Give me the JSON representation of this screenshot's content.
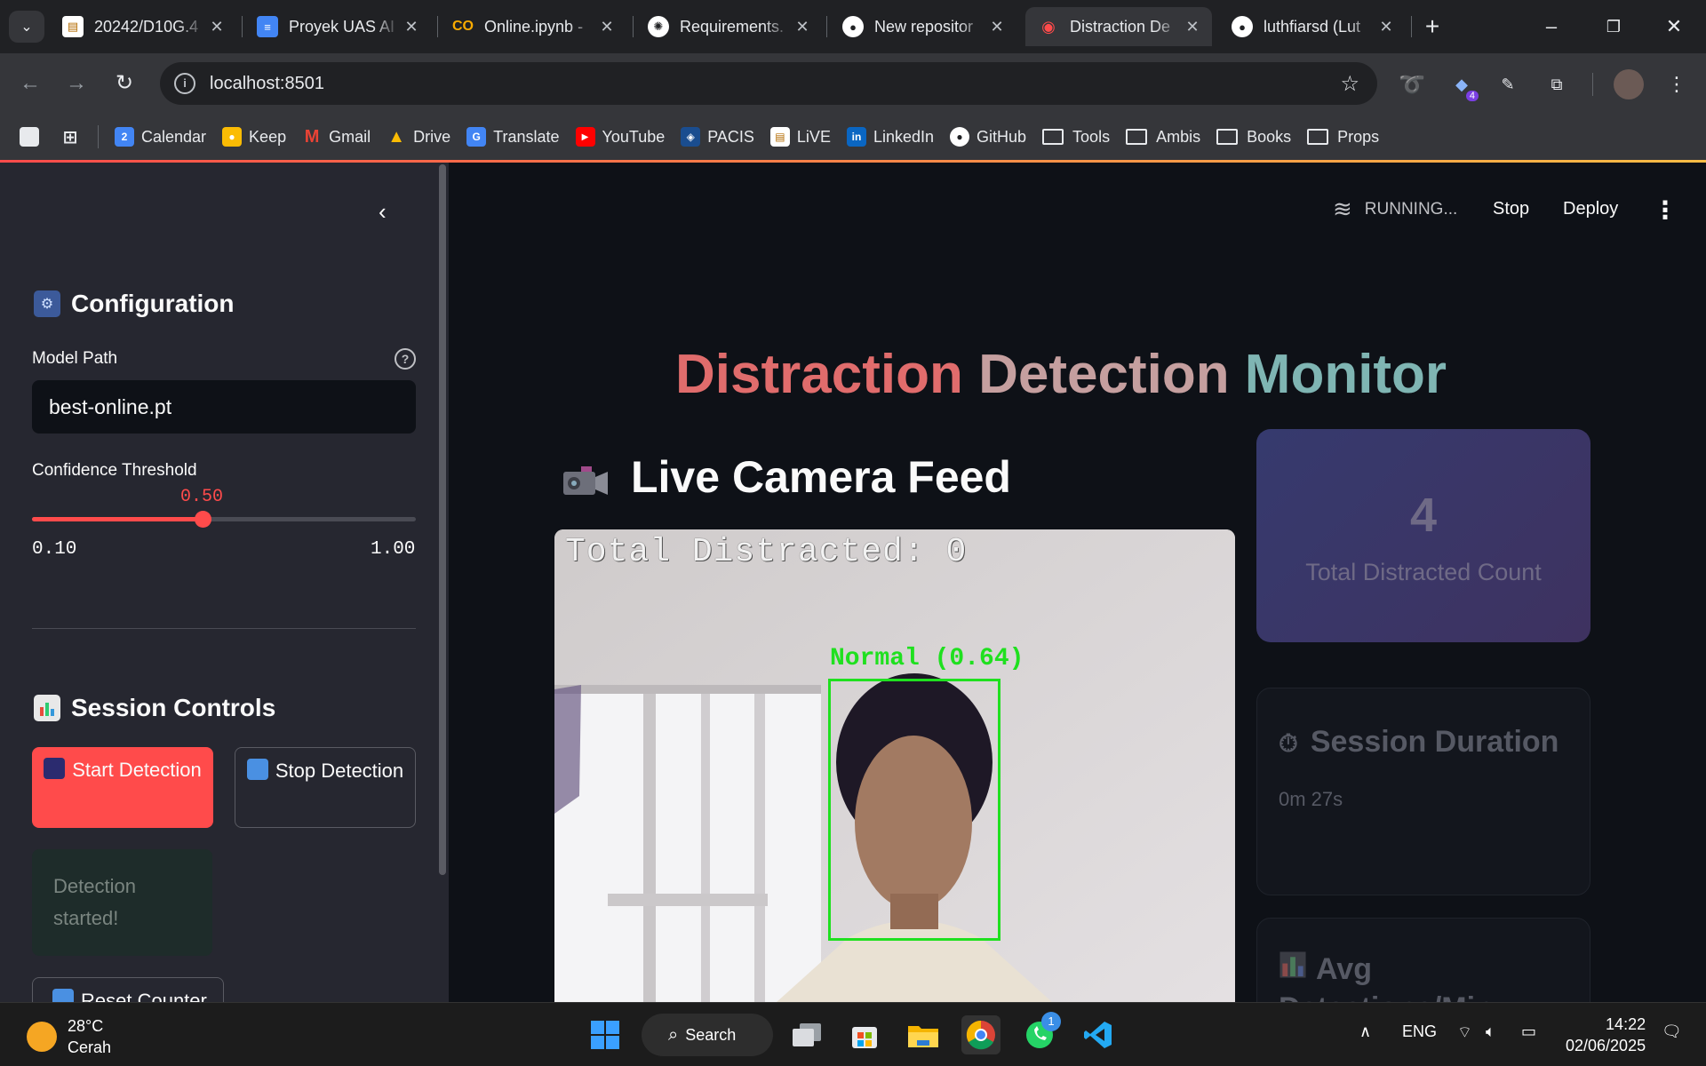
{
  "browser": {
    "tabs": [
      {
        "label": "20242/D10G.4",
        "icon": "doc-icon"
      },
      {
        "label": "Proyek UAS AI",
        "icon": "google-docs-icon"
      },
      {
        "label": "Online.ipynb -",
        "icon": "colab-icon"
      },
      {
        "label": "Requirements.",
        "icon": "openai-icon"
      },
      {
        "label": "New repositor",
        "icon": "github-icon"
      },
      {
        "label": "Distraction De",
        "icon": "streamlit-icon",
        "active": true
      },
      {
        "label": "luthfiarsd (Lut",
        "icon": "github-icon"
      }
    ],
    "url": "localhost:8501",
    "extension_badge": "4",
    "bookmarks": [
      "Calendar",
      "Keep",
      "Gmail",
      "Drive",
      "Translate",
      "YouTube",
      "PACIS",
      "LiVE",
      "LinkedIn",
      "GitHub",
      "Tools",
      "Ambis",
      "Books",
      "Props"
    ],
    "calendar_day": "2"
  },
  "sidebar": {
    "config_heading": "Configuration",
    "model_path_label": "Model Path",
    "model_path_value": "best-online.pt",
    "help": "?",
    "confidence_label": "Confidence Threshold",
    "confidence_value": "0.50",
    "confidence_fraction": 0.444,
    "confidence_min": "0.10",
    "confidence_max": "1.00",
    "session_heading": "Session Controls",
    "start_button": "Start Detection",
    "stop_button": "Stop Detection",
    "status_message": "Detection started!",
    "reset_button": "Reset Counter"
  },
  "header": {
    "status": "RUNNING...",
    "stop": "Stop",
    "deploy": "Deploy"
  },
  "main": {
    "title_words": [
      "Distraction",
      "Detection",
      "Monitor"
    ],
    "live_heading": "Live Camera Feed",
    "feed_overlay": "Total Distracted: 0",
    "detection_label": "Normal (0.64)",
    "count_value": "4",
    "count_caption": "Total Distracted Count",
    "duration_heading": "Session Duration",
    "duration_value": "0m 27s",
    "avg_heading": "Avg Detections/Min"
  },
  "taskbar": {
    "temperature": "28°C",
    "weather": "Cerah",
    "search": "Search",
    "whatsapp_badge": "1",
    "language": "ENG",
    "time": "14:22",
    "date": "02/06/2025"
  }
}
